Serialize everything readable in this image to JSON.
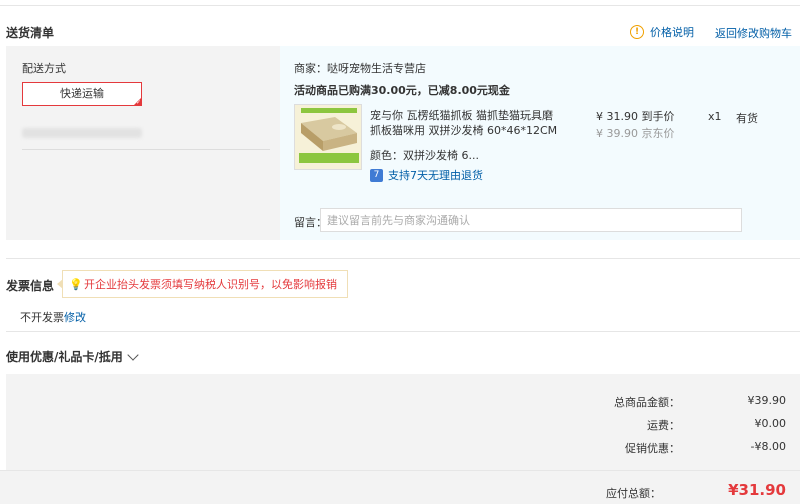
{
  "header": {
    "title": "送货清单",
    "price_note": "价格说明",
    "back_to_cart": "返回修改购物车",
    "info_icon": "info-icon"
  },
  "shipping": {
    "label": "配送方式",
    "method": "快递运输"
  },
  "order": {
    "shop": "商家：哒呀宠物生活专营店",
    "promo": "活动商品已购满30.00元，已减8.00元现金",
    "item_title": "宠与你 瓦楞纸猫抓板 猫抓垫猫玩具磨抓板猫咪用 双拼沙发椅 60*46*12CM",
    "color": "颜色：双拼沙发椅 6...",
    "return_icon": "7",
    "return_policy": "支持7天无理由退货",
    "price": "¥ 31.90 到手价",
    "jd_price": "¥ 39.90 京东价",
    "quantity": "x1",
    "stock": "有货",
    "message_label": "留言：",
    "message_placeholder": "建议留言前先与商家沟通确认"
  },
  "invoice": {
    "title": "发票信息",
    "tip": "开企业抬头发票须填写纳税人识别号，以免影响报销",
    "status": "不开发票",
    "edit": "修改"
  },
  "coupon": {
    "title": "使用优惠/礼品卡/抵用"
  },
  "summary": {
    "rows": [
      {
        "label": "总商品金额：",
        "value": "¥39.90"
      },
      {
        "label": "运费：",
        "value": "¥0.00"
      },
      {
        "label": "促销优惠：",
        "value": "-¥8.00"
      }
    ],
    "payable_label": "应付总额：",
    "payable_value": "¥31.90"
  },
  "colors": {
    "accent_red": "#e4393c",
    "link_blue": "#005ea7",
    "warn_orange": "#f0a000"
  }
}
